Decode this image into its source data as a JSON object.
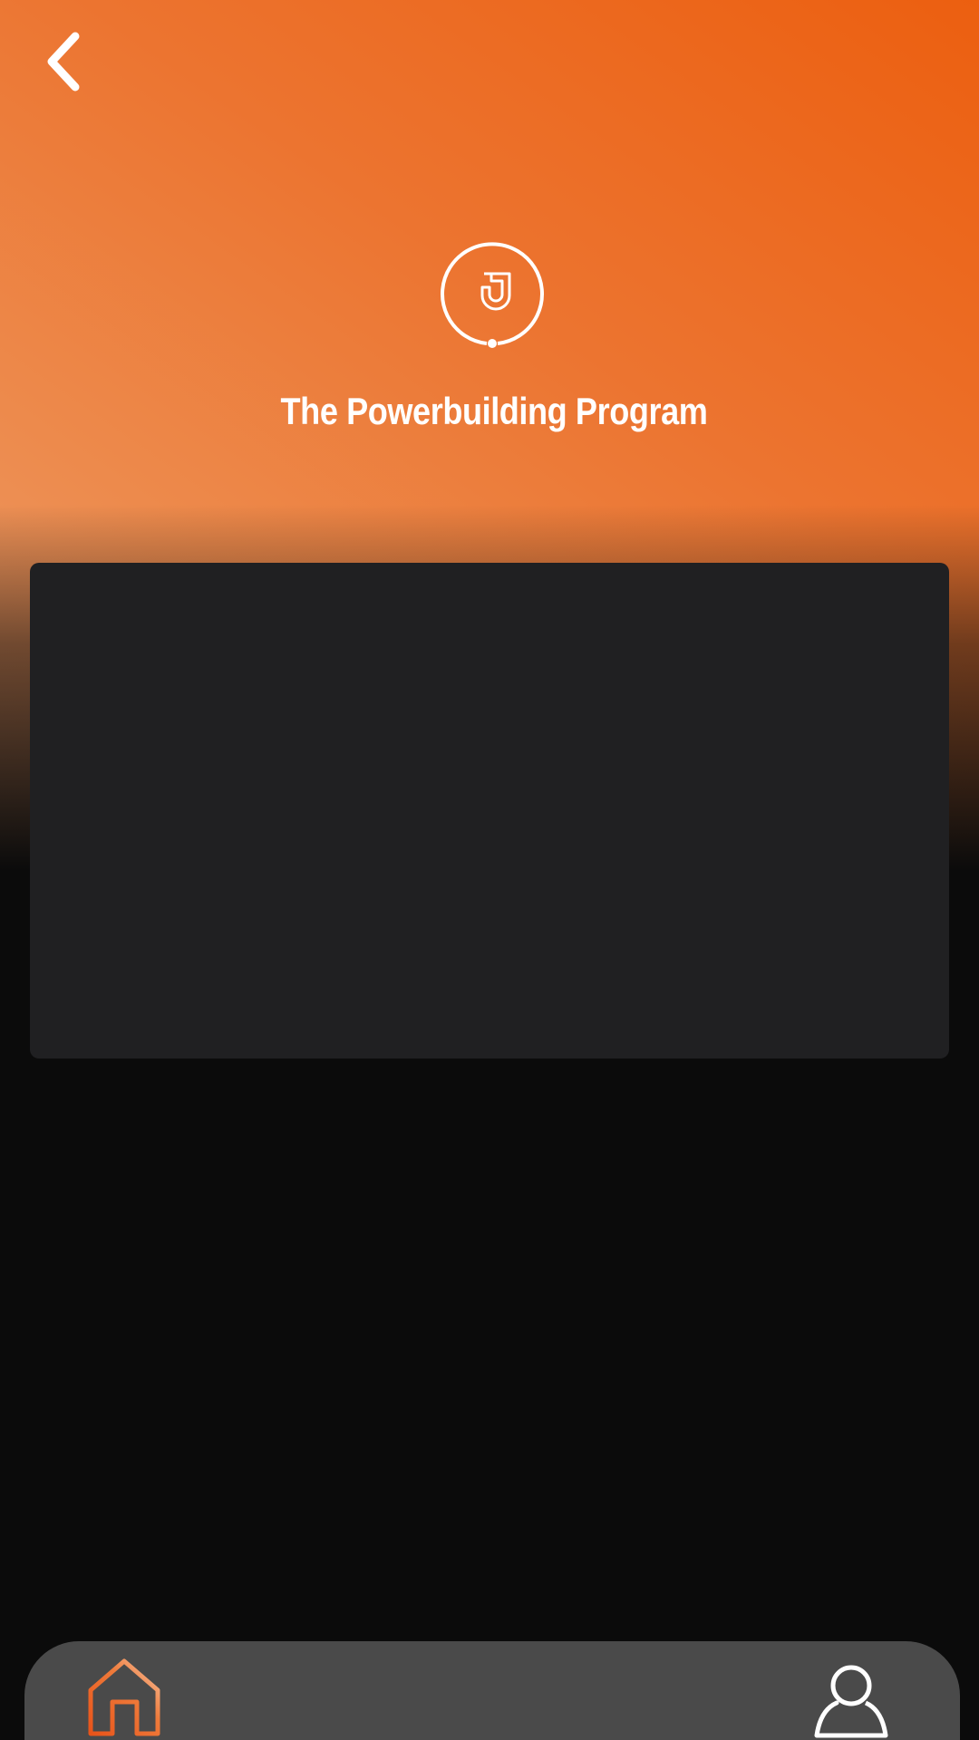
{
  "app": {
    "program_title": "The Powerbuilding Program"
  },
  "icons": {
    "back": "chevron-left-icon",
    "logo": "j-circle-logo-icon",
    "home": "home-icon",
    "profile": "user-icon"
  },
  "colors": {
    "gradient_light": "#eda06e",
    "gradient_dark": "#ec5f10",
    "background": "#0b0b0b",
    "card": "#202022",
    "nav_bar": "#4a4a4a",
    "active_icon": "#e8541a"
  }
}
